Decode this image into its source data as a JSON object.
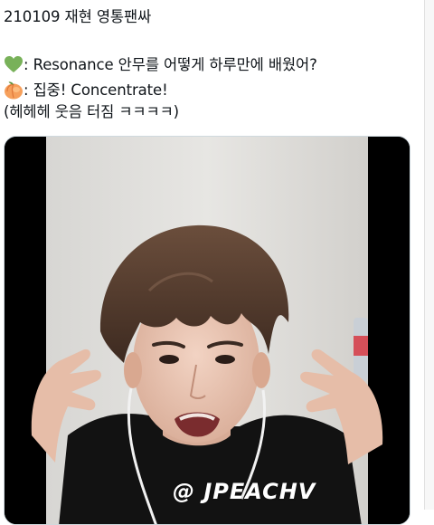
{
  "tweet": {
    "title_line": "210109 재현 영통팬싸",
    "line_resonance": ":  Resonance 안무를 어떻게 하루만에 배웠어?",
    "line_concentrate": ": 집중!  Concentrate!",
    "line_laugh": "(헤헤헤 웃음 터짐 ㅋㅋㅋㅋ)",
    "emoji_1": "green-heart-icon",
    "emoji_2": "peach-icon"
  },
  "media": {
    "watermark": "@ JPEACHV"
  },
  "colors": {
    "text": "#0f1419",
    "green_heart": "#78b159",
    "peach": "#f4900c",
    "frame_border": "#cfd9de"
  }
}
